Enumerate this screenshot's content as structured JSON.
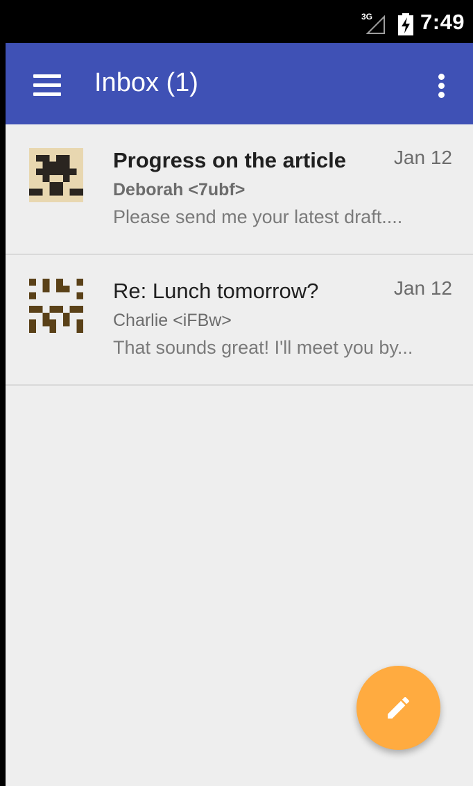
{
  "status_bar": {
    "network_type": "3G",
    "time": "7:49"
  },
  "app_bar": {
    "title": "Inbox (1)",
    "menu_icon": "hamburger-menu-icon",
    "overflow_icon": "more-vert-icon",
    "color": "#3f51b5"
  },
  "emails": [
    {
      "subject": "Progress on the article",
      "sender": "Deborah <7ubf>",
      "date": "Jan 12",
      "snippet": "Please send me your latest draft....",
      "unread": true
    },
    {
      "subject": "Re: Lunch tomorrow?",
      "sender": "Charlie <iFBw>",
      "date": "Jan 12",
      "snippet": "That sounds great! I'll meet you by...",
      "unread": false
    }
  ],
  "fab": {
    "icon": "edit-pencil-icon",
    "color": "#ffab40"
  }
}
